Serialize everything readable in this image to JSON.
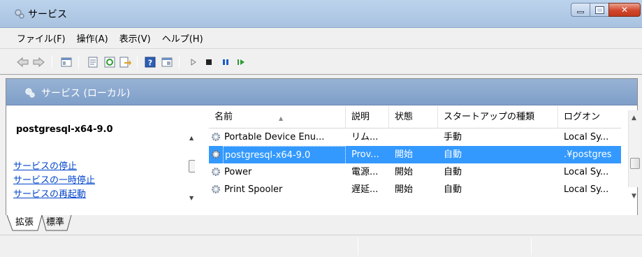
{
  "window": {
    "title": "サービス"
  },
  "menu": [
    "ファイル(F)",
    "操作(A)",
    "表示(V)",
    "ヘルプ(H)"
  ],
  "toolbar": {
    "icons": [
      "back-icon",
      "forward-icon",
      "show-tree-icon",
      "properties-icon",
      "refresh-icon",
      "export-icon",
      "help-icon",
      "console-tree-icon",
      "start-icon",
      "stop-icon",
      "pause-icon",
      "resume-icon"
    ]
  },
  "header": {
    "title": "サービス (ローカル)"
  },
  "left_panel": {
    "selected_service": "postgresql-x64-9.0",
    "links": [
      "サービスの停止",
      "サービスの一時停止",
      "サービスの再起動"
    ]
  },
  "columns": [
    "名前",
    "説明",
    "状態",
    "スタートアップの種類",
    "ログオン"
  ],
  "rows": [
    {
      "name": "Portable Device Enu...",
      "desc": "リム...",
      "status": "",
      "startup": "手動",
      "logon": "Local Sy...",
      "selected": false
    },
    {
      "name": "postgresql-x64-9.0",
      "desc": "Prov...",
      "status": "開始",
      "startup": "自動",
      "logon": ".¥postgres",
      "selected": true
    },
    {
      "name": "Power",
      "desc": "電源...",
      "status": "開始",
      "startup": "自動",
      "logon": "Local Sy...",
      "selected": false
    },
    {
      "name": "Print Spooler",
      "desc": "遅延...",
      "status": "開始",
      "startup": "自動",
      "logon": "Local Sy...",
      "selected": false
    }
  ],
  "tabs": [
    "拡張",
    "標準"
  ],
  "colors": {
    "selection": "#3399ff",
    "header_blue": "#8aa8cf",
    "link": "#0044cc"
  }
}
